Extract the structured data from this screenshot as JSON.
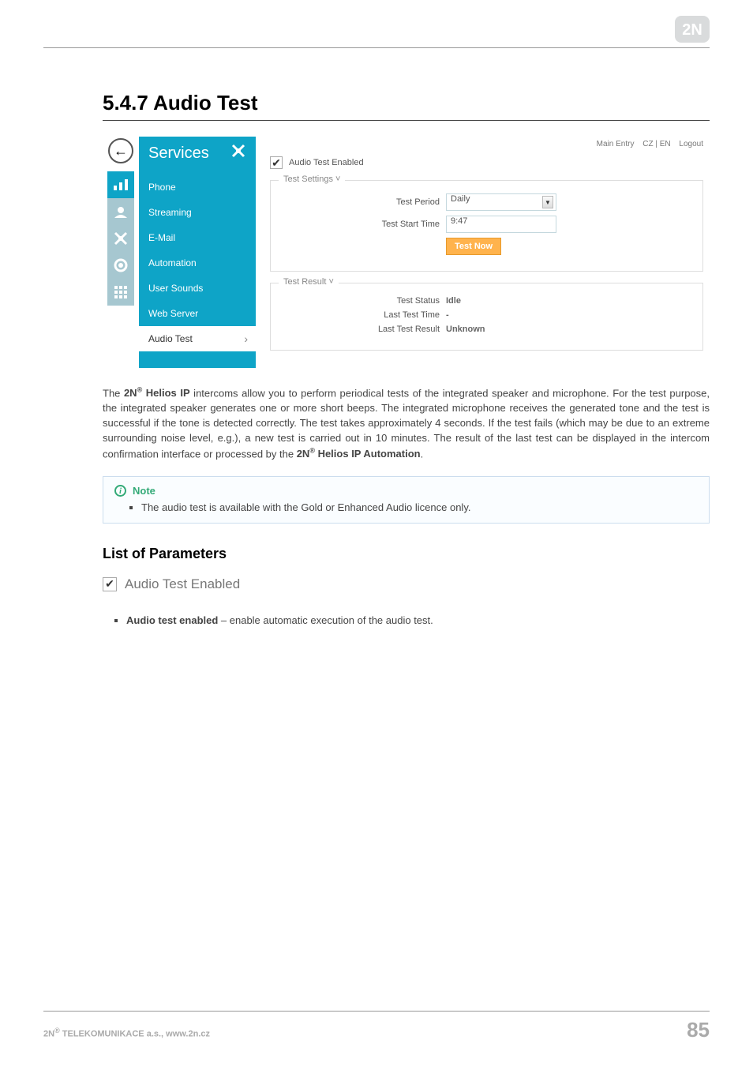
{
  "logo_text": "2N",
  "section_title": "5.4.7 Audio Test",
  "screenshot": {
    "toplinks": {
      "main": "Main Entry",
      "lang": "CZ | EN",
      "logout": "Logout"
    },
    "back_glyph": "←",
    "sidebar_title": "Services",
    "sidebar_icon": "✕",
    "items": [
      {
        "label": "Phone"
      },
      {
        "label": "Streaming"
      },
      {
        "label": "E-Mail"
      },
      {
        "label": "Automation"
      },
      {
        "label": "User Sounds"
      },
      {
        "label": "Web Server"
      },
      {
        "label": "Audio Test",
        "active": true
      }
    ],
    "icons": [
      "▮▮",
      "👥",
      "✕",
      "⚙",
      "▦"
    ],
    "checkbox_label": "Audio Test Enabled",
    "settings": {
      "legend": "Test Settings ˅",
      "period_label": "Test Period",
      "period_value": "Daily",
      "start_label": "Test Start Time",
      "start_value": "9:47",
      "button": "Test Now"
    },
    "result": {
      "legend": "Test Result ˅",
      "status_label": "Test Status",
      "status_value": "Idle",
      "time_label": "Last Test Time",
      "time_value": "-",
      "result_label": "Last Test Result",
      "result_value": "Unknown"
    }
  },
  "body_para_pre": "The ",
  "body_brand1": "2N",
  "body_sup": "®",
  "body_brand2": " Helios IP",
  "body_para_mid": " intercoms allow you to perform periodical tests of the integrated speaker and microphone. For the test purpose, the integrated speaker generates one or more short beeps. The integrated microphone receives the generated tone and the test is successful if the tone is detected correctly. The test takes approximately 4 seconds. If the test fails (which may be due to an extreme surrounding noise level, e.g.), a new test is carried out in 10 minutes. The result of the last test can be displayed in the intercom confirmation interface or processed by the ",
  "body_brand3": "2N",
  "body_brand4": " Helios IP Automation",
  "body_para_end": ".",
  "note": {
    "title": "Note",
    "item": "The audio test is available with the Gold or Enhanced Audio licence only."
  },
  "subhead": "List of Parameters",
  "param_checkbox_label": "Audio Test Enabled",
  "param_item_name": "Audio test enabled",
  "param_item_desc": " – enable automatic execution of the audio test.",
  "footer": {
    "left_pre": "2N",
    "left_sup": "®",
    "left_post": " TELEKOMUNIKACE a.s., www.2n.cz",
    "page": "85"
  }
}
